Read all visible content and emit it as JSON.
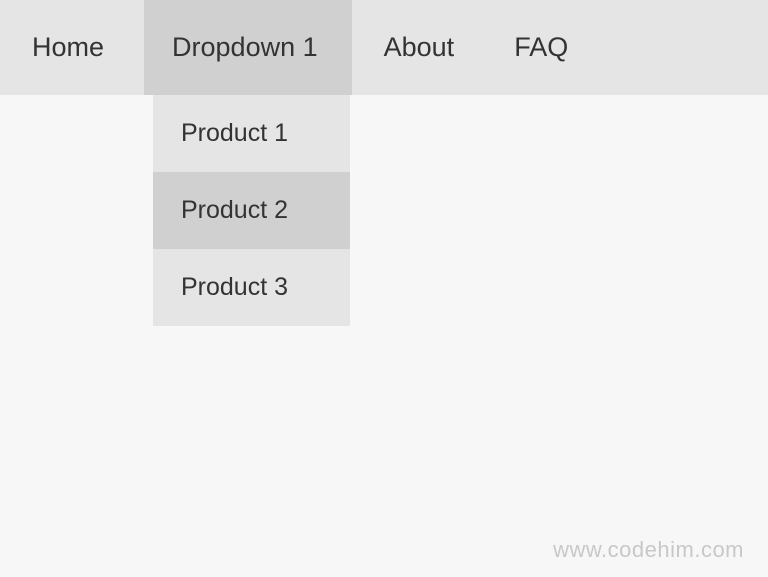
{
  "nav": {
    "items": [
      {
        "label": "Home"
      },
      {
        "label": "Dropdown 1"
      },
      {
        "label": "About"
      },
      {
        "label": "FAQ"
      }
    ]
  },
  "dropdown": {
    "items": [
      {
        "label": "Product 1"
      },
      {
        "label": "Product 2"
      },
      {
        "label": "Product 3"
      }
    ]
  },
  "watermark": "www.codehim.com"
}
